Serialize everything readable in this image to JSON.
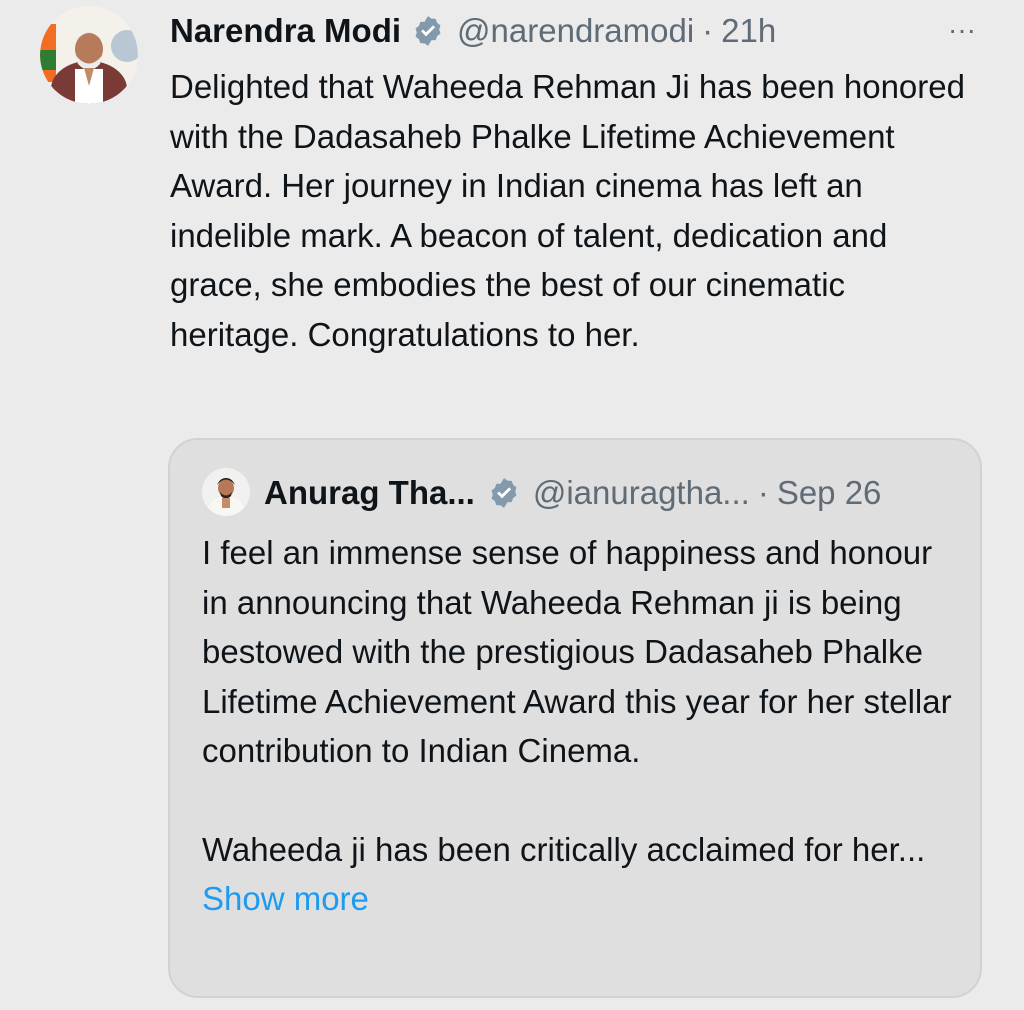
{
  "tweet": {
    "author_name": "Narendra Modi",
    "author_handle": "@narendramodi",
    "dot": "·",
    "time": "21h",
    "more_label": "···",
    "text": "Delighted that Waheeda Rehman Ji has been honored with the Dadasaheb Phalke Lifetime Achievement Award. Her journey in Indian cinema has left an indelible mark. A beacon of talent, dedication and grace, she embodies the best of our cinematic heritage. Congratulations to her."
  },
  "quoted": {
    "author_name": "Anurag Tha...",
    "author_handle": "@ianuragtha...",
    "dot": "·",
    "time": "Sep 26",
    "paragraph_1": "I feel an immense sense of happiness and honour in announcing that Waheeda Rehman ji is being bestowed with the prestigious Dadasaheb Phalke Lifetime Achievement Award this year for her stellar contribution to Indian Cinema.",
    "paragraph_2_prefix": "Waheeda ji has been critically acclaimed for her...",
    "show_more": "Show more"
  },
  "icons": {
    "verified": "verified-badge-icon",
    "more": "more-options-icon"
  },
  "colors": {
    "background": "#ebebeb",
    "quote_background": "#dfdfdf",
    "verified_badge": "#829aab",
    "link": "#1d9bf0",
    "secondary_text": "#5f6b76"
  }
}
